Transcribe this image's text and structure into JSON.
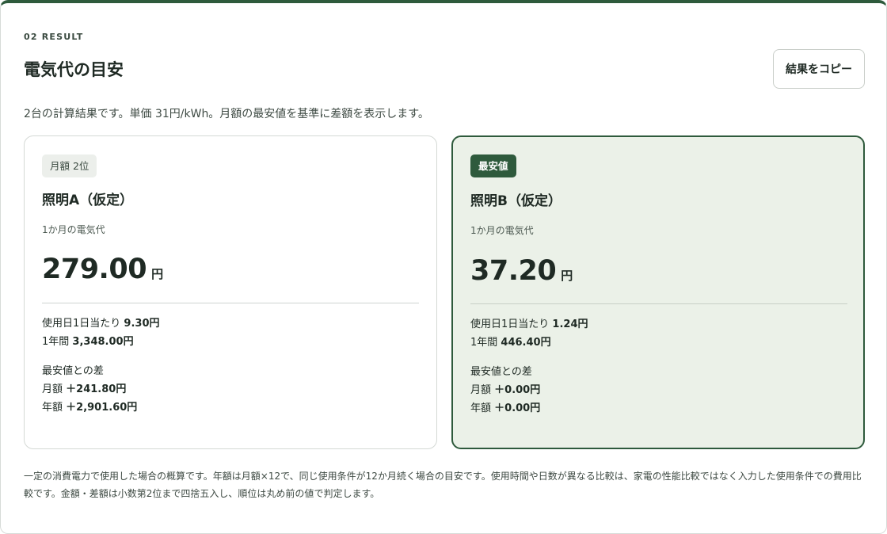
{
  "section": {
    "eyebrow": "02 RESULT",
    "title": "電気代の目安",
    "copy_button_label": "結果をコピー",
    "summary": "2台の計算結果です。単価 31円/kWh。月額の最安値を基準に差額を表示します。"
  },
  "cards": [
    {
      "badge": "月額 2位",
      "name": "照明A（仮定）",
      "monthly_label": "1か月の電気代",
      "monthly_amount": "279.00",
      "currency": "円",
      "daily_label": "使用日1日当たり",
      "daily_value": "9.30円",
      "yearly_label": "1年間",
      "yearly_value": "3,348.00円",
      "diff_label": "最安値との差",
      "diff_monthly_label": "月額",
      "diff_monthly_value": "＋241.80円",
      "diff_yearly_label": "年額",
      "diff_yearly_value": "＋2,901.60円"
    },
    {
      "badge": "最安値",
      "name": "照明B（仮定）",
      "monthly_label": "1か月の電気代",
      "monthly_amount": "37.20",
      "currency": "円",
      "daily_label": "使用日1日当たり",
      "daily_value": "1.24円",
      "yearly_label": "1年間",
      "yearly_value": "446.40円",
      "diff_label": "最安値との差",
      "diff_monthly_label": "月額",
      "diff_monthly_value": "＋0.00円",
      "diff_yearly_label": "年額",
      "diff_yearly_value": "＋0.00円"
    }
  ],
  "footnote": "一定の消費電力で使用した場合の概算です。年額は月額×12で、同じ使用条件が12か月続く場合の目安です。使用時間や日数が異なる比較は、家電の性能比較ではなく入力した使用条件での費用比較です。金額・差額は小数第2位まで四捨五入し、順位は丸め前の値で判定します。",
  "colors": {
    "accent": "#2e5a3c",
    "best_card_bg": "#ebf1e8"
  }
}
